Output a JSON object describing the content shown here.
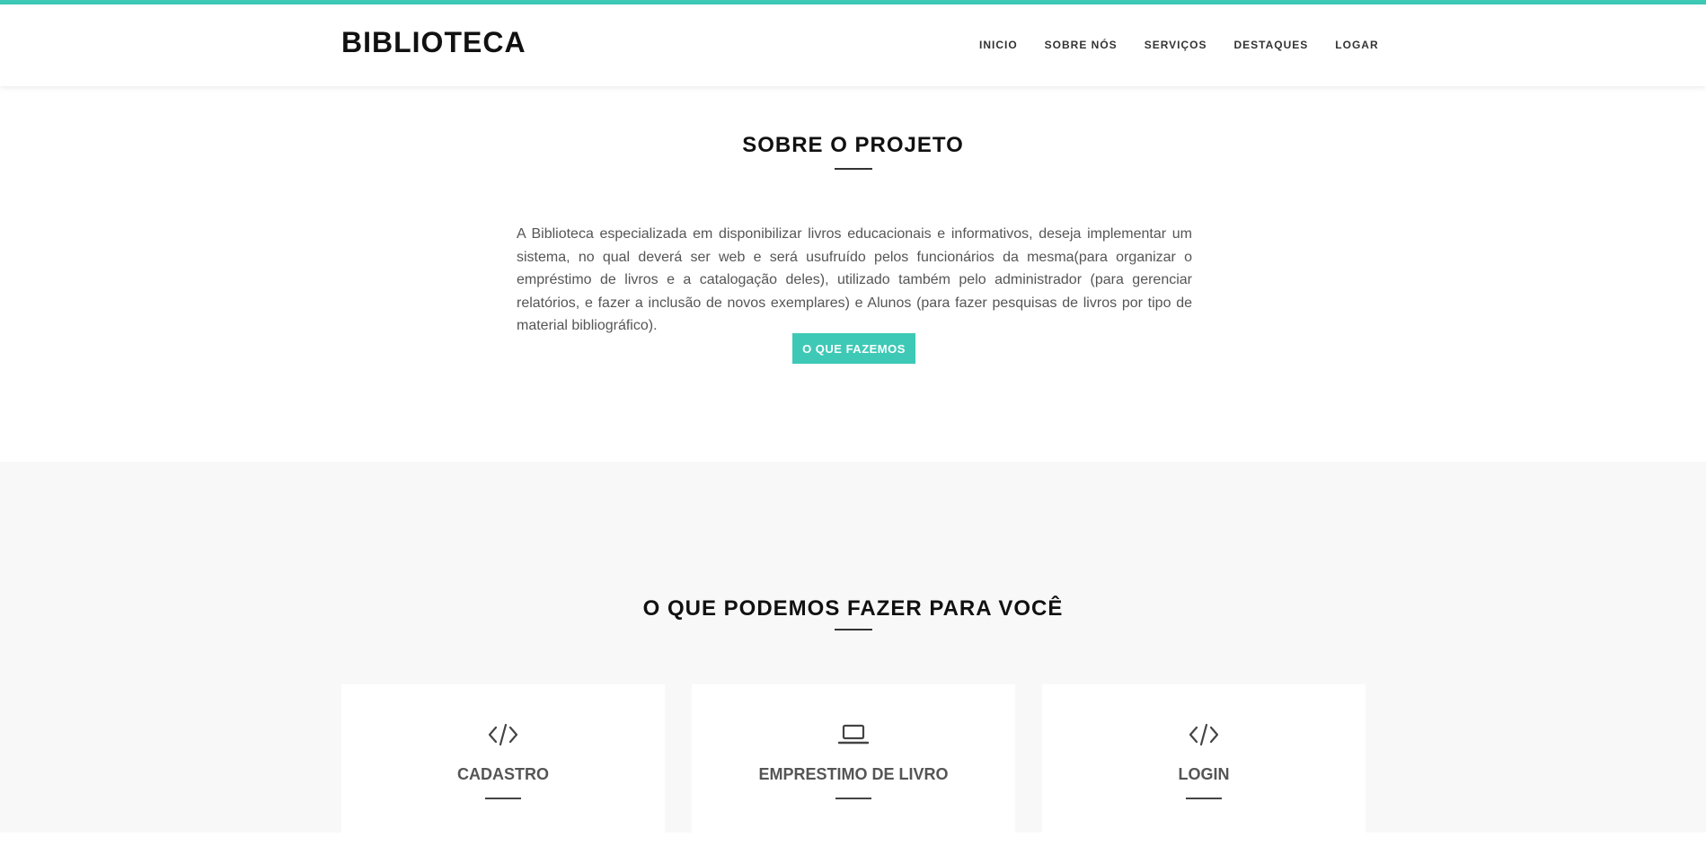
{
  "brand": "BIBLIOTECA",
  "nav": {
    "items": [
      {
        "label": "INICIO"
      },
      {
        "label": "SOBRE NÓS"
      },
      {
        "label": "SERVIÇOS"
      },
      {
        "label": "DESTAQUES"
      },
      {
        "label": "LOGAR"
      }
    ]
  },
  "about": {
    "title": "SOBRE O PROJETO",
    "text": "A Biblioteca especializada em disponibilizar livros educacionais e informativos, deseja implementar um sistema, no qual deverá ser web e será usufruído pelos funcionários da mesma(para organizar o empréstimo de livros e a catalogação deles), utilizado também pelo administrador (para gerenciar relatórios, e fazer a inclusão de novos exemplares) e Alunos (para fazer pesquisas de livros por tipo de material bibliográfico).",
    "button_label": "O QUE FAZEMOS"
  },
  "services": {
    "title": "O QUE PODEMOS FAZER PARA VOCÊ",
    "cards": [
      {
        "icon": "code-icon",
        "title": "CADASTRO"
      },
      {
        "icon": "laptop-icon",
        "title": "EMPRESTIMO DE LIVRO"
      },
      {
        "icon": "code-icon",
        "title": "LOGIN"
      }
    ]
  },
  "colors": {
    "accent": "#3ec9b6",
    "section_bg": "#f8f8f8"
  }
}
